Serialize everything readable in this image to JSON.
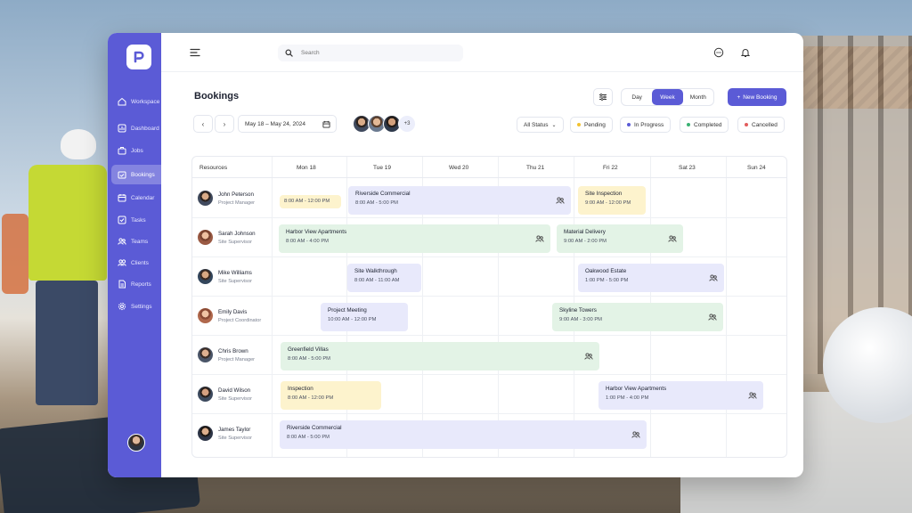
{
  "search": {
    "placeholder": "Search"
  },
  "sidebar": {
    "items": [
      {
        "label": "Workspace",
        "icon": "home-icon"
      },
      {
        "label": "Dashboard",
        "icon": "dashboard-icon"
      },
      {
        "label": "Jobs",
        "icon": "briefcase-icon"
      },
      {
        "label": "Bookings",
        "icon": "calendar-check-icon"
      },
      {
        "label": "Calendar",
        "icon": "calendar-icon"
      },
      {
        "label": "Tasks",
        "icon": "checkbox-icon"
      },
      {
        "label": "Teams",
        "icon": "users-icon"
      },
      {
        "label": "Clients",
        "icon": "clients-icon"
      },
      {
        "label": "Reports",
        "icon": "report-icon"
      },
      {
        "label": "Settings",
        "icon": "gear-icon"
      }
    ],
    "active": "Bookings"
  },
  "page": {
    "title": "Bookings"
  },
  "views": {
    "day": "Day",
    "week": "Week",
    "month": "Month",
    "selected": "Week"
  },
  "new_booking": "New Booking",
  "date_range": "May 18 – May 24, 2024",
  "team_more": "+3",
  "filters": {
    "status": "All Status",
    "pending": "Pending",
    "in_progress": "In Progress",
    "completed": "Completed",
    "cancelled": "Cancelled"
  },
  "colors": {
    "accent": "#5b5bd6",
    "pending": "#f2c230",
    "in_progress": "#5b5bd6",
    "completed": "#3bb273",
    "cancelled": "#e25c5c"
  },
  "grid": {
    "resources_header": "Resources",
    "days": [
      "Mon 18",
      "Tue 19",
      "Wed 20",
      "Thu 21",
      "Fri 22",
      "Sat 23",
      "Sun 24"
    ],
    "rows": [
      {
        "name": "John Peterson",
        "role": "Project Manager",
        "bookings": [
          {
            "title": "",
            "time": "8:00 AM - 12:00 PM",
            "status": "pending"
          },
          {
            "title": "Riverside Commercial",
            "time": "8:00 AM - 5:00 PM",
            "status": "in_progress",
            "team": true
          },
          {
            "title": "Site Inspection",
            "time": "9:00 AM - 12:00 PM",
            "status": "pending"
          }
        ]
      },
      {
        "name": "Sarah Johnson",
        "role": "Site Supervisor",
        "bookings": [
          {
            "title": "Harbor View Apartments",
            "time": "8:00 AM - 4:00 PM",
            "status": "completed",
            "team": true
          },
          {
            "title": "Material Delivery",
            "time": "9:00 AM - 2:00 PM",
            "status": "completed",
            "team": true
          }
        ]
      },
      {
        "name": "Mike Williams",
        "role": "Site Supervisor",
        "bookings": [
          {
            "title": "Site Walkthrough",
            "time": "8:00 AM - 11:00 AM",
            "status": "in_progress"
          },
          {
            "title": "Oakwood Estate",
            "time": "1:00 PM - 5:00 PM",
            "status": "in_progress",
            "team": true
          }
        ]
      },
      {
        "name": "Emily Davis",
        "role": "Project Coordinator",
        "bookings": [
          {
            "title": "Project Meeting",
            "time": "10:00 AM - 12:00 PM",
            "status": "in_progress"
          },
          {
            "title": "Skyline Towers",
            "time": "9:00 AM - 3:00 PM",
            "status": "completed",
            "team": true
          }
        ]
      },
      {
        "name": "Chris Brown",
        "role": "Project Manager",
        "bookings": [
          {
            "title": "Greenfield Villas",
            "time": "8:00 AM - 5:00 PM",
            "status": "completed",
            "team": true
          }
        ]
      },
      {
        "name": "David Wilson",
        "role": "Site Supervisor",
        "bookings": [
          {
            "title": "Inspection",
            "time": "8:00 AM - 12:00 PM",
            "status": "pending"
          },
          {
            "title": "Harbor View Apartments",
            "time": "1:00 PM - 4:00 PM",
            "status": "in_progress",
            "team": true
          }
        ]
      },
      {
        "name": "James Taylor",
        "role": "Site Supervisor",
        "bookings": [
          {
            "title": "Riverside Commercial",
            "time": "8:00 AM - 5:00 PM",
            "status": "in_progress",
            "team": true
          }
        ]
      }
    ]
  }
}
